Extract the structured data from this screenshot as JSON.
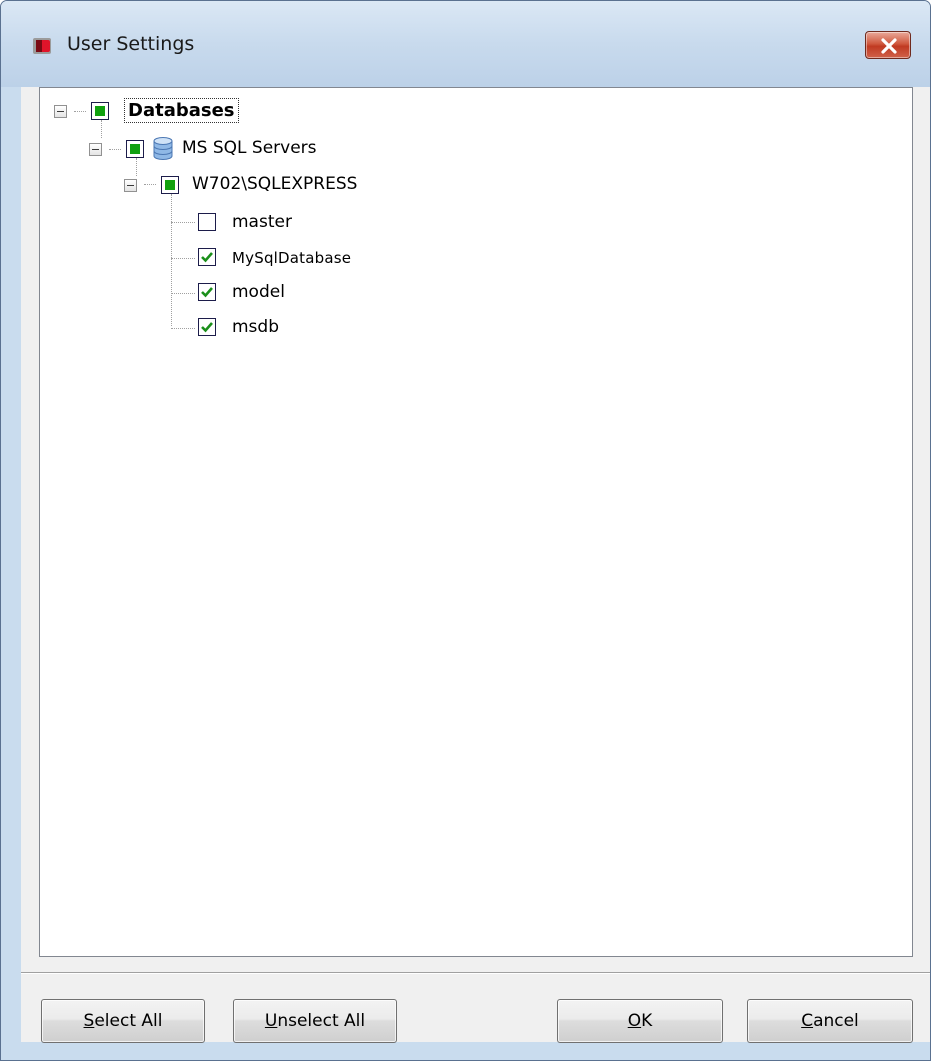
{
  "window": {
    "title": "User Settings"
  },
  "tree": {
    "root": {
      "label": "Databases",
      "state": "partial"
    },
    "servers_group": {
      "label": "MS SQL Servers",
      "state": "partial"
    },
    "server": {
      "label": "W702\\SQLEXPRESS",
      "state": "partial"
    },
    "databases": [
      {
        "label": "master",
        "checked": false
      },
      {
        "label": "MySqlDatabase",
        "checked": true
      },
      {
        "label": "model",
        "checked": true
      },
      {
        "label": "msdb",
        "checked": true
      }
    ]
  },
  "buttons": {
    "select_all": {
      "mnemonic": "S",
      "rest": "elect All"
    },
    "unselect_all": {
      "mnemonic": "U",
      "rest": "nselect All"
    },
    "ok": {
      "mnemonic": "O",
      "rest": "K"
    },
    "cancel": {
      "mnemonic": "C",
      "rest": "ancel"
    }
  },
  "colors": {
    "partial_check": "#10a010",
    "check_mark": "#1a8f1a",
    "close_button": "#c8452c"
  }
}
